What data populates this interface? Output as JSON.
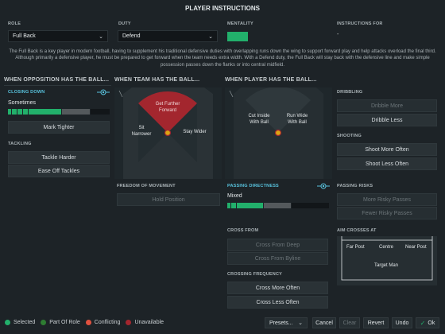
{
  "title": "PLAYER INSTRUCTIONS",
  "header": {
    "role_label": "ROLE",
    "role_value": "Full Back",
    "duty_label": "DUTY",
    "duty_value": "Defend",
    "mentality_label": "MENTALITY",
    "mentality_color": "#22b06b",
    "instructions_for_label": "INSTRUCTIONS FOR",
    "instructions_for_value": "-"
  },
  "description": "The Full Back is a key player in modern football, having to supplement his traditional defensive duties with overlapping runs down the wing to support forward play and help attacks overload the final third. Although primarily a defensive player, he must be prepared to get forward when the team needs extra width. With a Defend duty, the Full Back will stay back with the defensive line and make simple possession passes down the flanks or into central midfield.",
  "sections": {
    "opposition": "WHEN OPPOSITION HAS THE BALL...",
    "team": "WHEN TEAM HAS THE BALL...",
    "player": "WHEN PLAYER HAS THE BALL..."
  },
  "closing_down": {
    "label": "CLOSING DOWN",
    "value": "Sometimes",
    "level": 0.5,
    "button": "Mark Tighter"
  },
  "tackling": {
    "label": "TACKLING",
    "buttons": [
      "Tackle Harder",
      "Ease Off Tackles"
    ]
  },
  "team_pitch": {
    "forward": "Get Further Forward",
    "narrower": "Sit Narrower",
    "wider": "Stay Wider"
  },
  "freedom": {
    "label": "FREEDOM OF MOVEMENT",
    "button": "Hold Position"
  },
  "player_pitch": {
    "cut_inside": "Cut Inside With Ball",
    "run_wide": "Run Wide With Ball"
  },
  "passing_directness": {
    "label": "PASSING DIRECTNESS",
    "value": "Mixed",
    "level": 0.5
  },
  "cross_from": {
    "label": "CROSS FROM",
    "buttons": [
      "Cross From Deep",
      "Cross From Byline"
    ]
  },
  "crossing_frequency": {
    "label": "CROSSING FREQUENCY",
    "buttons": [
      "Cross More Often",
      "Cross Less Often"
    ]
  },
  "dribbling": {
    "label": "DRIBBLING",
    "buttons": [
      "Dribble More",
      "Dribble Less"
    ]
  },
  "shooting": {
    "label": "SHOOTING",
    "buttons": [
      "Shoot More Often",
      "Shoot Less Often"
    ]
  },
  "passing_risks": {
    "label": "PASSING RISKS",
    "buttons": [
      "More Risky Passes",
      "Fewer Risky Passes"
    ]
  },
  "aim_crosses": {
    "label": "AIM CROSSES AT",
    "far_post": "Far Post",
    "centre": "Centre",
    "near_post": "Near Post",
    "target_man": "Target Man"
  },
  "legend": [
    {
      "label": "Selected",
      "color": "#22b06b"
    },
    {
      "label": "Part Of Role",
      "color": "#2e7d32"
    },
    {
      "label": "Conflicting",
      "color": "#e0513f"
    },
    {
      "label": "Unavailable",
      "color": "#a3262e"
    }
  ],
  "footer": {
    "presets": "Presets...",
    "cancel": "Cancel",
    "clear": "Clear",
    "revert": "Revert",
    "undo": "Undo",
    "ok": "Ok"
  }
}
